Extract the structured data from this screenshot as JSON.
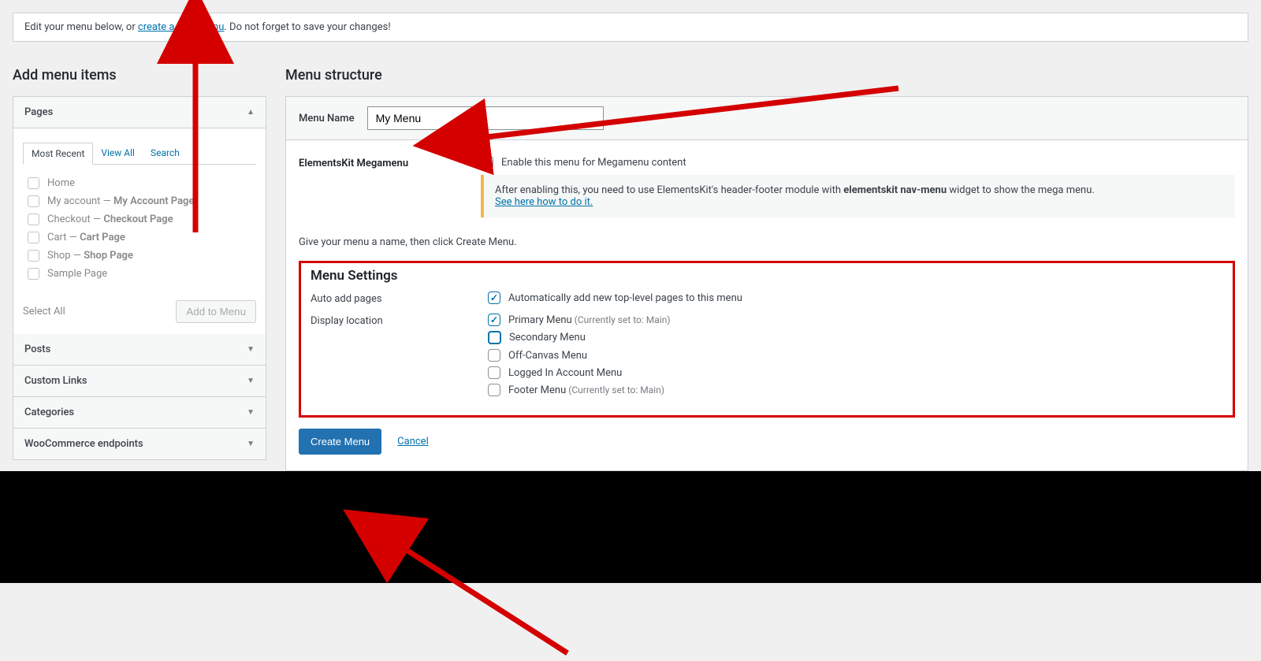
{
  "notice": {
    "pre": "Edit your menu below, or ",
    "link": "create a new menu",
    "post": ". Do not forget to save your changes!"
  },
  "left": {
    "title": "Add menu items",
    "pages_title": "Pages",
    "tabs": {
      "recent": "Most Recent",
      "all": "View All",
      "search": "Search"
    },
    "pages": [
      {
        "label": "Home"
      },
      {
        "label": "My account — ",
        "extra": "My Account Page"
      },
      {
        "label": "Checkout — ",
        "extra": "Checkout Page"
      },
      {
        "label": "Cart — ",
        "extra": "Cart Page"
      },
      {
        "label": "Shop — ",
        "extra": "Shop Page"
      },
      {
        "label": "Sample Page"
      }
    ],
    "select_all": "Select All",
    "add_btn": "Add to Menu",
    "sections": {
      "posts": "Posts",
      "custom": "Custom Links",
      "cats": "Categories",
      "woo": "WooCommerce endpoints"
    }
  },
  "right": {
    "title": "Menu structure",
    "menu_name_label": "Menu Name",
    "menu_name_value": "My Menu",
    "mega_label": "ElementsKit Megamenu",
    "mega_check": "Enable this menu for Megamenu content",
    "info_pre": "After enabling this, you need to use ElementsKit's header-footer module with ",
    "info_bold": "elementskit nav-menu",
    "info_post": " widget to show the mega menu. ",
    "info_link": "See here how to do it.",
    "hint": "Give your menu a name, then click Create Menu.",
    "settings_title": "Menu Settings",
    "auto_label": "Auto add pages",
    "auto_text": "Automatically add new top-level pages to this menu",
    "loc_label": "Display location",
    "locs": {
      "primary": "Primary Menu",
      "primary_hint": "(Currently set to: Main)",
      "secondary": "Secondary Menu",
      "offcanvas": "Off-Canvas Menu",
      "logged": "Logged In Account Menu",
      "footer": "Footer Menu",
      "footer_hint": "(Currently set to: Main)"
    },
    "create_btn": "Create Menu",
    "cancel": "Cancel"
  }
}
